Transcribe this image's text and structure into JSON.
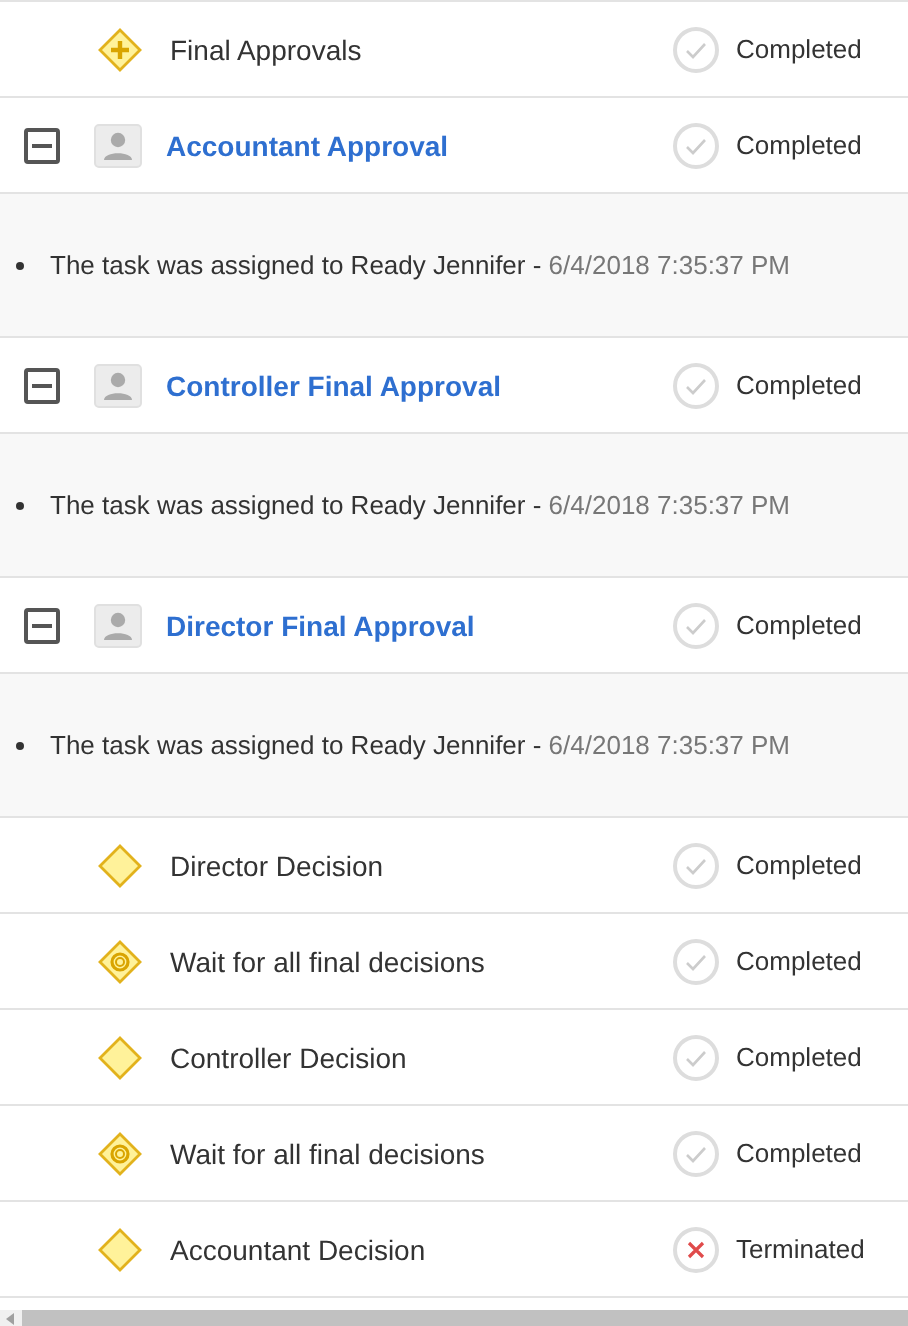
{
  "items": [
    {
      "kind": "parallel-gateway",
      "label": "Final Approvals",
      "status": {
        "kind": "completed",
        "label": "Completed"
      }
    },
    {
      "kind": "task",
      "label": "Accountant Approval",
      "expanded": true,
      "status": {
        "kind": "completed",
        "label": "Completed"
      },
      "details": [
        {
          "text": "The task was assigned to Ready Jennifer - ",
          "time": "6/4/2018 7:35:37 PM"
        }
      ]
    },
    {
      "kind": "task",
      "label": "Controller Final Approval",
      "expanded": true,
      "status": {
        "kind": "completed",
        "label": "Completed"
      },
      "details": [
        {
          "text": "The task was assigned to Ready Jennifer - ",
          "time": "6/4/2018 7:35:37 PM"
        }
      ]
    },
    {
      "kind": "task",
      "label": "Director Final Approval",
      "expanded": true,
      "status": {
        "kind": "completed",
        "label": "Completed"
      },
      "details": [
        {
          "text": "The task was assigned to Ready Jennifer - ",
          "time": "6/4/2018 7:35:37 PM"
        }
      ]
    },
    {
      "kind": "exclusive-gateway",
      "label": "Director Decision",
      "status": {
        "kind": "completed",
        "label": "Completed"
      }
    },
    {
      "kind": "event-gateway",
      "label": "Wait for all final decisions",
      "status": {
        "kind": "completed",
        "label": "Completed"
      }
    },
    {
      "kind": "exclusive-gateway",
      "label": "Controller Decision",
      "status": {
        "kind": "completed",
        "label": "Completed"
      }
    },
    {
      "kind": "event-gateway",
      "label": "Wait for all final decisions",
      "status": {
        "kind": "completed",
        "label": "Completed"
      }
    },
    {
      "kind": "exclusive-gateway",
      "label": "Accountant Decision",
      "status": {
        "kind": "terminated",
        "label": "Terminated"
      }
    }
  ]
}
